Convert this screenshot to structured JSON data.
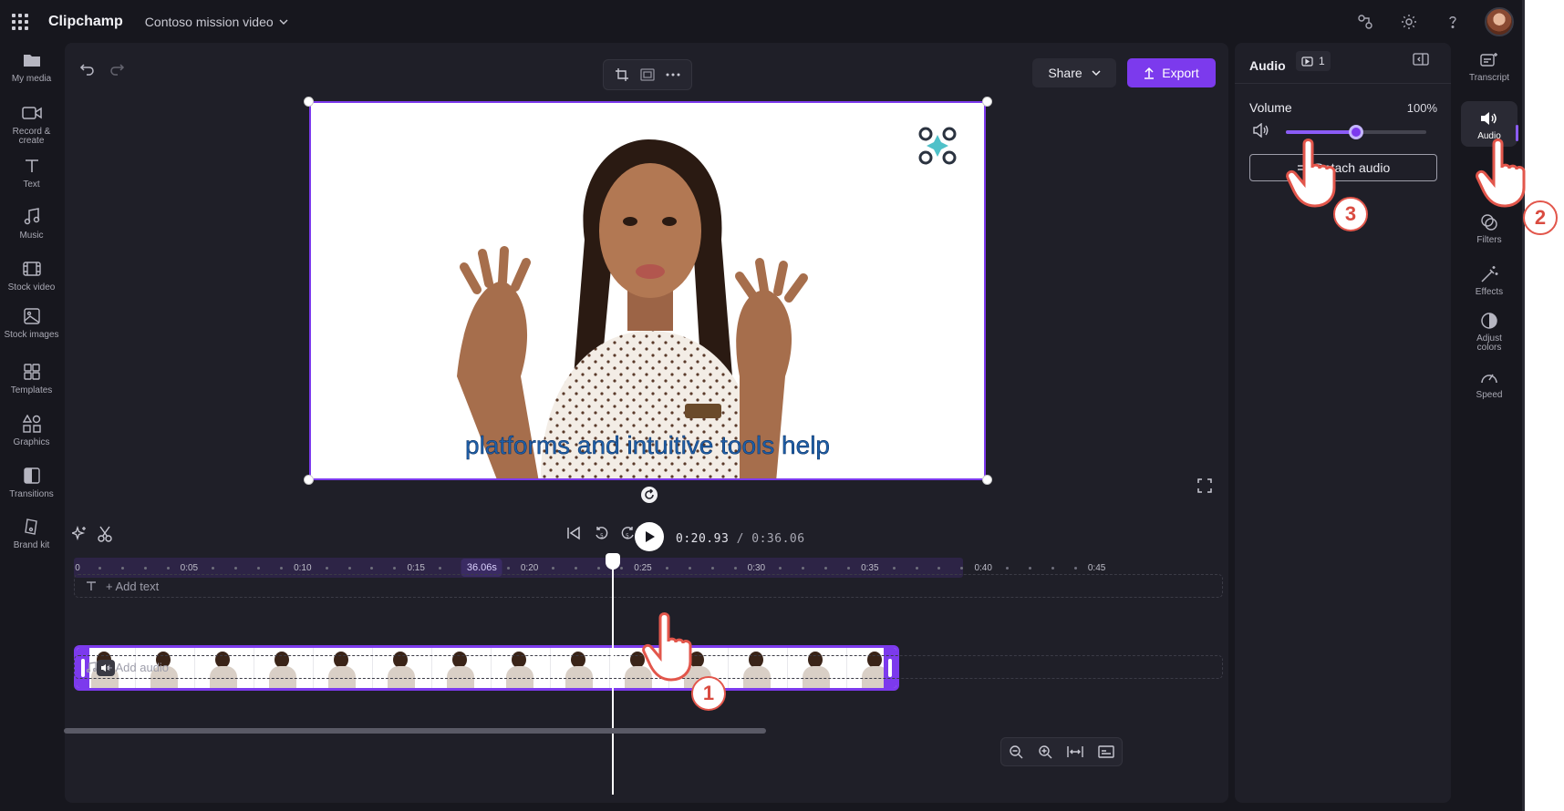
{
  "app": {
    "brand": "Clipchamp",
    "project_title": "Contoso mission video"
  },
  "left_sidebar": {
    "items": [
      {
        "label": "My media",
        "icon": "folder-icon"
      },
      {
        "label": "Record & create",
        "icon": "camera-icon"
      },
      {
        "label": "Text",
        "icon": "text-icon"
      },
      {
        "label": "Music",
        "icon": "music-icon"
      },
      {
        "label": "Stock video",
        "icon": "film-icon"
      },
      {
        "label": "Stock images",
        "icon": "image-icon"
      },
      {
        "label": "Templates",
        "icon": "templates-icon"
      },
      {
        "label": "Graphics",
        "icon": "shapes-icon"
      },
      {
        "label": "Transitions",
        "icon": "transition-icon"
      },
      {
        "label": "Brand kit",
        "icon": "brand-kit-icon"
      }
    ]
  },
  "toolbar": {
    "share_label": "Share",
    "export_label": "Export"
  },
  "preview": {
    "caption": "platforms and intuitive tools help"
  },
  "playback": {
    "current_time": "0:20.93",
    "total_time": "/ 0:36.06"
  },
  "timeline": {
    "ticks": [
      {
        "label": "0",
        "x": 0
      },
      {
        "label": "0:05",
        "x": 5
      },
      {
        "label": "0:10",
        "x": 10
      },
      {
        "label": "0:15",
        "x": 15
      },
      {
        "label": "0:20",
        "x": 20
      },
      {
        "label": "0:25",
        "x": 25
      },
      {
        "label": "0:30",
        "x": 30
      },
      {
        "label": "0:35",
        "x": 35
      },
      {
        "label": "0:40",
        "x": 40
      },
      {
        "label": "0:45",
        "x": 45
      }
    ],
    "duration_badge": "36.06s",
    "playhead_time_s": 20.93,
    "add_text_label": "+ Add text",
    "add_audio_label": "+ Add audio"
  },
  "audio_panel": {
    "title": "Audio",
    "clip_count": "1",
    "volume_label": "Volume",
    "volume_value": "100%",
    "volume_fraction": 0.5,
    "detach_label": "Detach audio"
  },
  "right_sidebar": {
    "items": [
      {
        "label": "Transcript",
        "icon": "transcript-icon"
      },
      {
        "label": "Audio",
        "icon": "speaker-icon"
      },
      {
        "label": "Filters",
        "icon": "filters-icon"
      },
      {
        "label": "Effects",
        "icon": "magic-wand-icon"
      },
      {
        "label": "Adjust colors",
        "icon": "contrast-icon"
      },
      {
        "label": "Speed",
        "icon": "speedometer-icon"
      }
    ]
  },
  "tutorial_steps": [
    "1",
    "2",
    "3"
  ],
  "colors": {
    "accent": "#7c3aed",
    "background": "#17171e",
    "panel": "#1f1f28",
    "caption": "#1f5fa8",
    "step_badge": "#e2564b"
  }
}
